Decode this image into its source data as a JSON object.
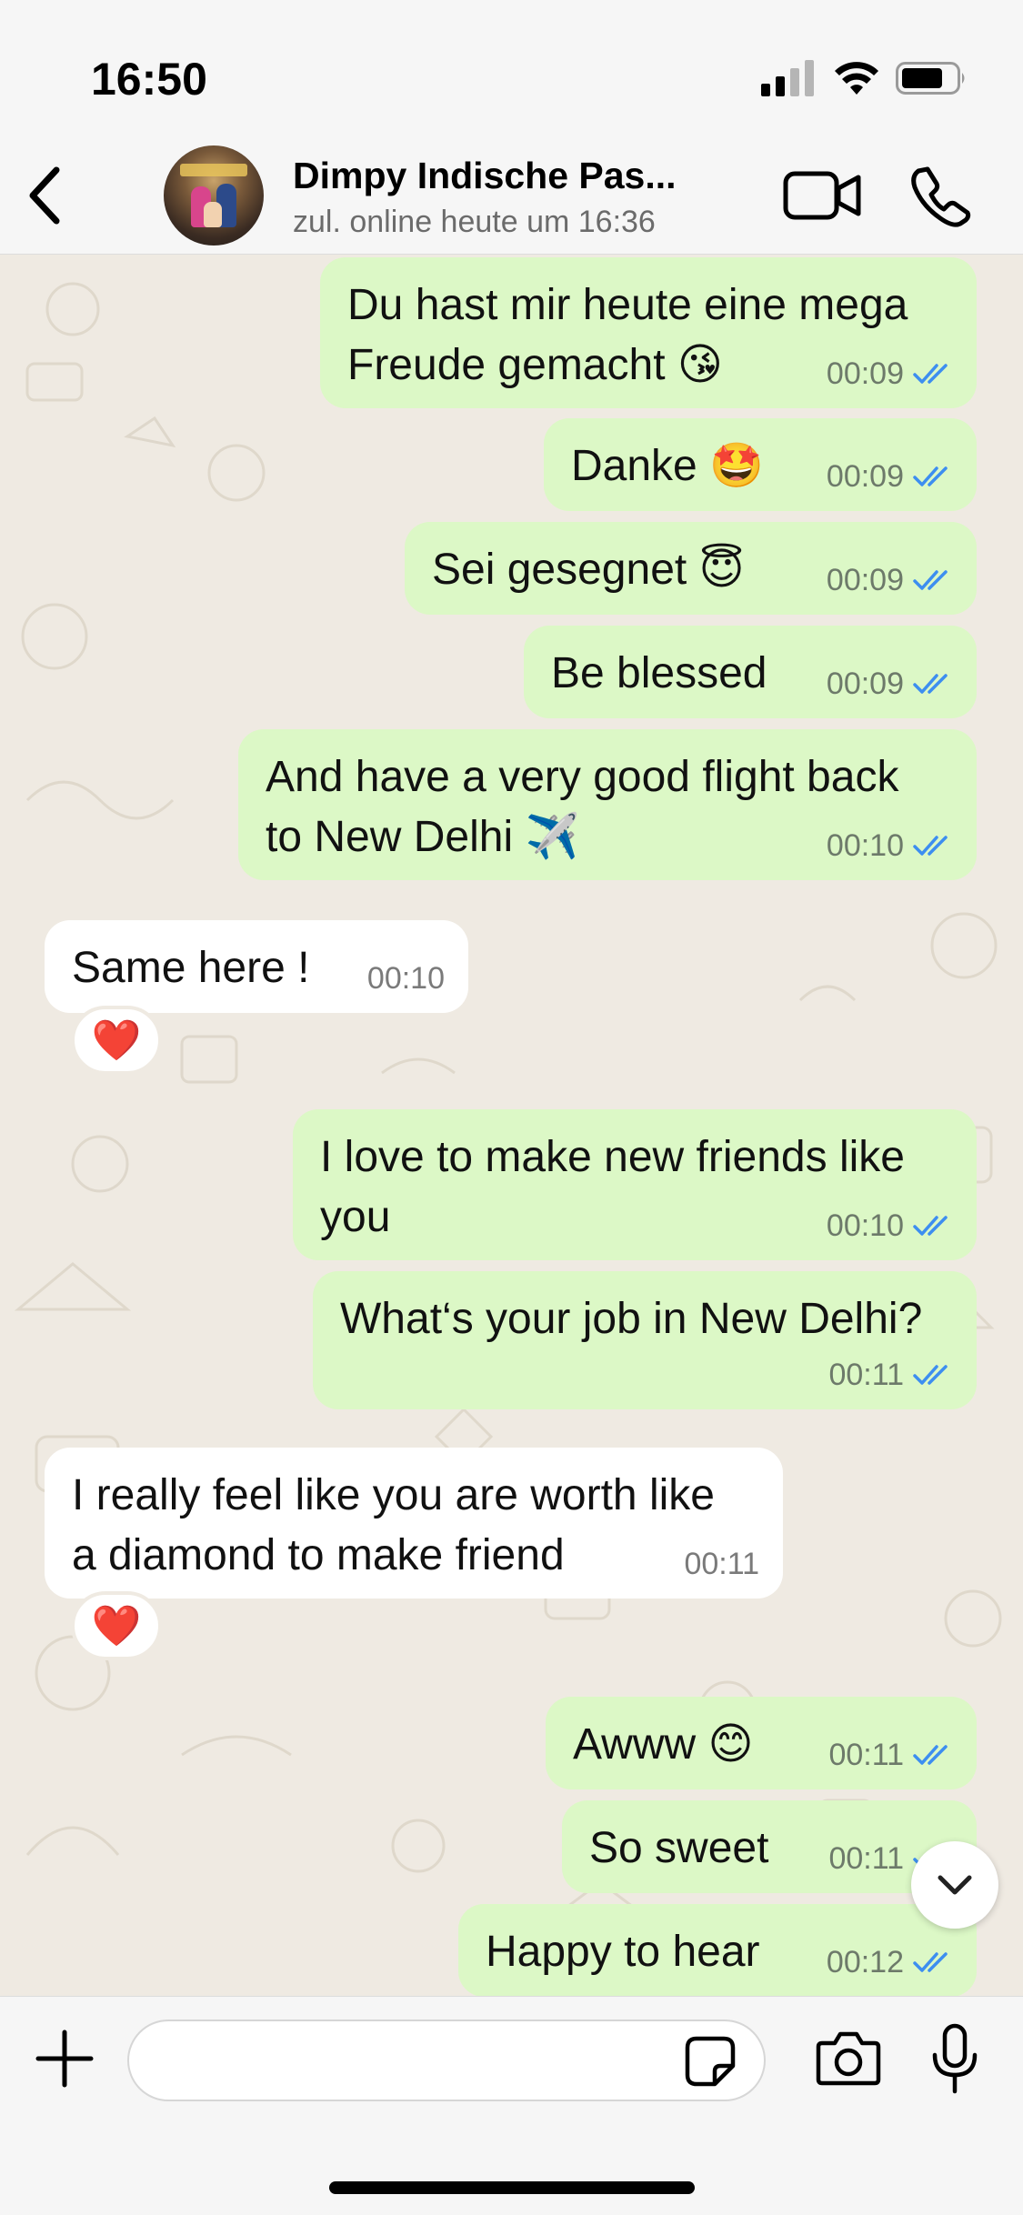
{
  "status_bar": {
    "time": "16:50"
  },
  "header": {
    "contact_name": "Dimpy Indische Pas...",
    "last_seen": "zul. online heute um 16:36"
  },
  "messages": [
    {
      "dir": "out",
      "lines": [
        "Du hast mir heute eine mega",
        "Freude gemacht 😘"
      ],
      "time": "00:09",
      "read": true
    },
    {
      "dir": "out",
      "lines": [
        "Danke 🤩"
      ],
      "time": "00:09",
      "read": true
    },
    {
      "dir": "out",
      "lines": [
        "Sei gesegnet 😇"
      ],
      "time": "00:09",
      "read": true
    },
    {
      "dir": "out",
      "lines": [
        "Be blessed"
      ],
      "time": "00:09",
      "read": true
    },
    {
      "dir": "out",
      "lines": [
        "And have a very good flight back",
        "to New Delhi ✈️"
      ],
      "time": "00:10",
      "read": true
    },
    {
      "dir": "in",
      "lines": [
        "Same here !"
      ],
      "time": "00:10",
      "reaction": "❤️"
    },
    {
      "dir": "out",
      "lines": [
        "I love to make new friends like",
        "you"
      ],
      "time": "00:10",
      "read": true
    },
    {
      "dir": "out",
      "lines": [
        "What‘s your job in New Delhi?"
      ],
      "time": "00:11",
      "read": true
    },
    {
      "dir": "in",
      "lines": [
        "I really feel like you are worth like",
        "a diamond to make friend"
      ],
      "time": "00:11",
      "reaction": "❤️"
    },
    {
      "dir": "out",
      "lines": [
        "Awww 😊"
      ],
      "time": "00:11",
      "read": true
    },
    {
      "dir": "out",
      "lines": [
        "So sweet"
      ],
      "time": "00:11",
      "read": true
    },
    {
      "dir": "out",
      "lines": [
        "Happy to hear"
      ],
      "time": "00:12",
      "read": true
    }
  ],
  "input": {
    "placeholder": ""
  },
  "icons": {
    "back": "chevron-left-icon",
    "video_call": "video-camera-icon",
    "voice_call": "phone-icon",
    "scroll_down": "chevron-down-icon",
    "attach": "plus-icon",
    "sticker": "sticker-icon",
    "camera": "camera-icon",
    "mic": "microphone-icon"
  },
  "colors": {
    "outgoing_bubble": "#dcf8c6",
    "incoming_bubble": "#ffffff",
    "read_ticks": "#3d8ef0",
    "chat_background": "#efeae2"
  }
}
